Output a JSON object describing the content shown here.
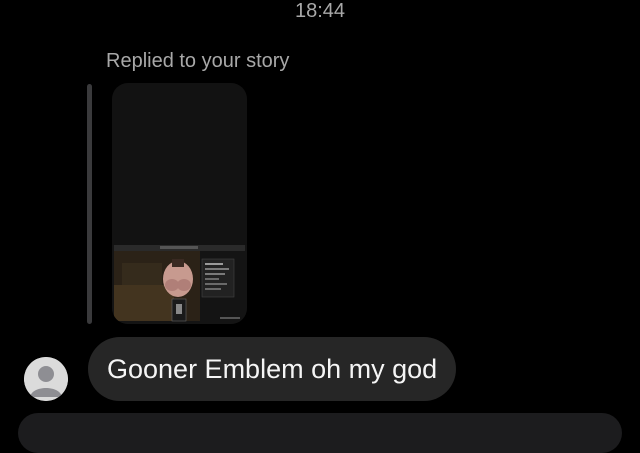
{
  "timestamp": "18:44",
  "reply_context": "Replied to your story",
  "message": {
    "text": "Gooner Emblem oh my god",
    "avatar_icon": "default-avatar-icon"
  },
  "story": {
    "thumbnail_icon": "story-screenshot-thumbnail"
  },
  "colors": {
    "background": "#000000",
    "bubble": "#262626",
    "muted_text": "#a8a8a8",
    "message_text": "#f5f5f5"
  }
}
